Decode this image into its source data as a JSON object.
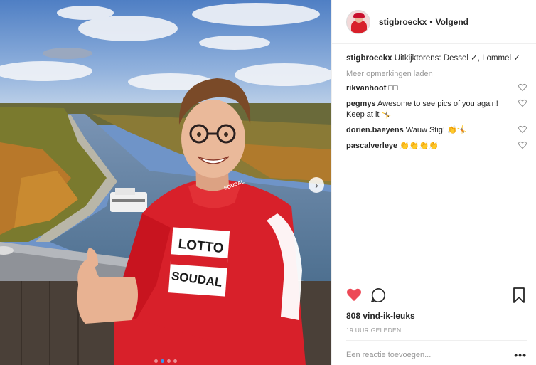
{
  "post": {
    "username": "stigbroeckx",
    "separator": "•",
    "follow_label": "Volgend",
    "caption_user": "stigbroeckx",
    "caption_text": "Uitkijktorens: Dessel ✓, Lommel ✓",
    "load_more": "Meer opmerkingen laden",
    "comments": [
      {
        "user": "rikvanhoof",
        "text": "□□"
      },
      {
        "user": "pegmys",
        "text": "Awesome to see pics of you again! Keep at it 🤸"
      },
      {
        "user": "dorien.baeyens",
        "text": "Wauw Stig! 👏🤸"
      },
      {
        "user": "pascalverleye",
        "text": "👏👏👏👏"
      }
    ],
    "likes": "808 vind-ik-leuks",
    "timestamp": "19 UUR GELEDEN",
    "comment_placeholder": "Een reactie toevoegen...",
    "options": "•••",
    "next_icon": "chevron-right-icon",
    "carousel": {
      "count": 4,
      "active_index": 1
    }
  },
  "photo": {
    "jersey_lotto": "LOTTO",
    "jersey_soudal": "SOUDAL",
    "collar_text": "SOUDAL"
  },
  "colors": {
    "liked_heart": "#ed4956",
    "carousel_active": "#3897f0",
    "jersey_red": "#d8202a"
  }
}
